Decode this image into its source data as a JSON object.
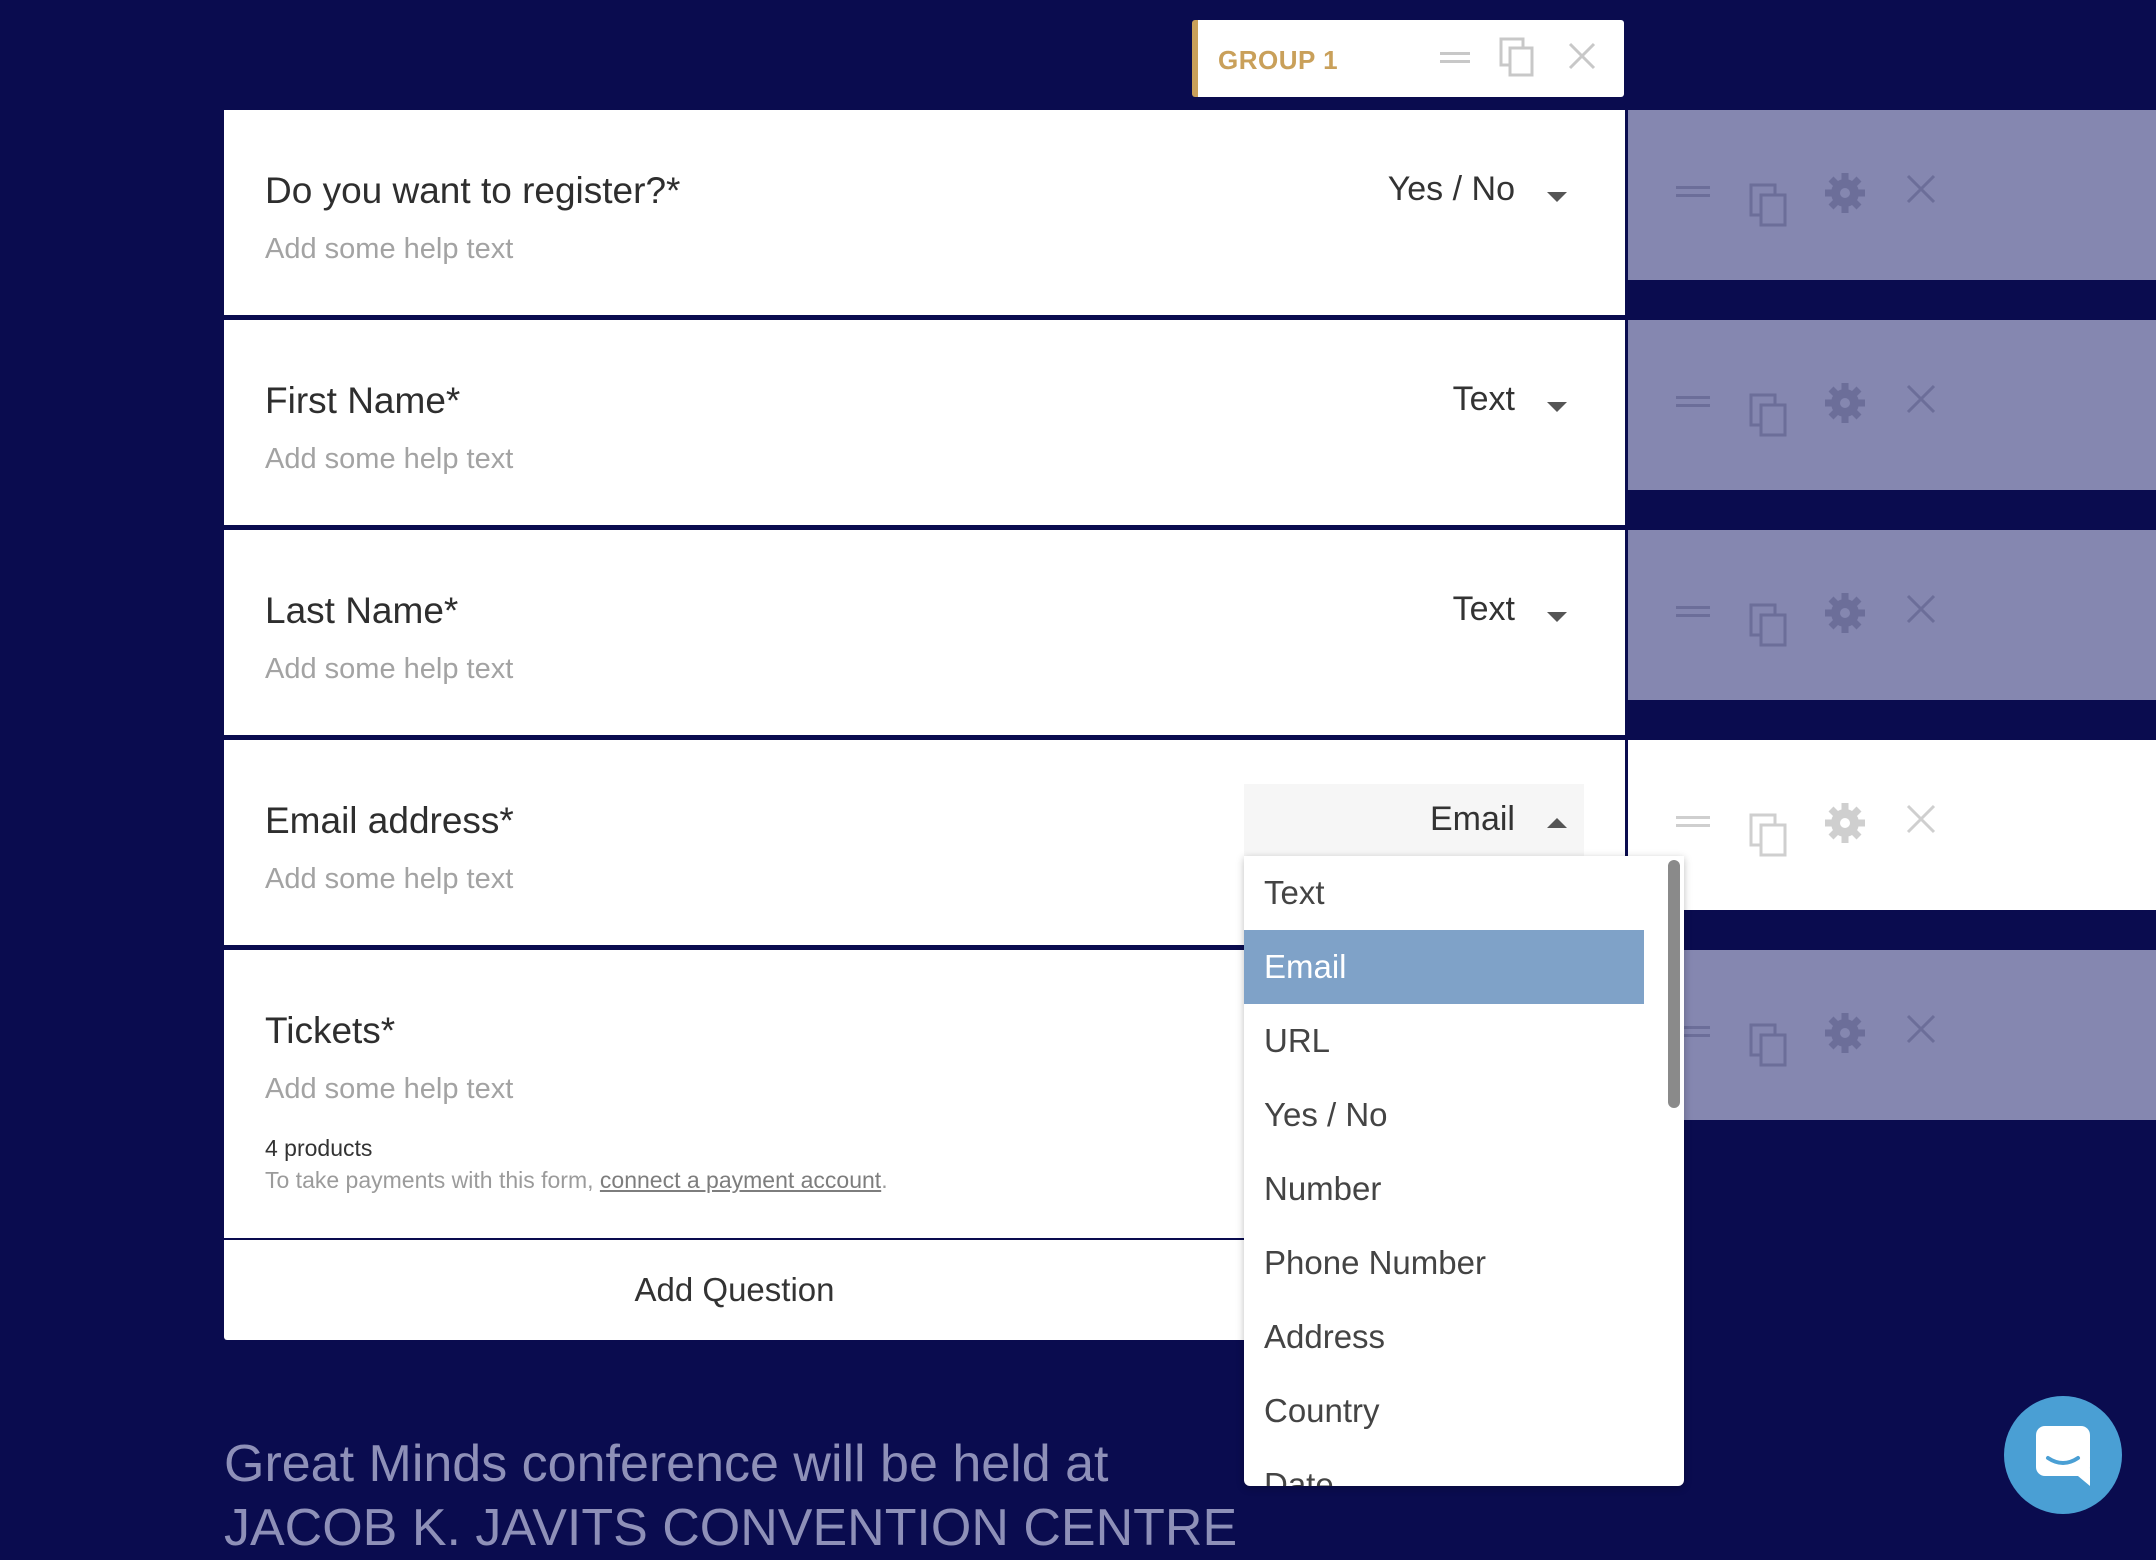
{
  "group": {
    "label": "GROUP 1"
  },
  "questions": [
    {
      "label": "Do you want to register?*",
      "help": "Add some help text",
      "type": "Yes / No"
    },
    {
      "label": "First Name*",
      "help": "Add some help text",
      "type": "Text"
    },
    {
      "label": "Last Name*",
      "help": "Add some help text",
      "type": "Text"
    },
    {
      "label": "Email address*",
      "help": "Add some help text",
      "type": "Email"
    },
    {
      "label": "Tickets*",
      "help": "Add some help text",
      "products": "4 products",
      "payment_note": "To take payments with this form, ",
      "payment_link": "connect a payment account",
      "payment_end": "."
    }
  ],
  "add_question": "Add Question",
  "dropdown": {
    "selected": "Email",
    "options": [
      "Text",
      "Email",
      "URL",
      "Yes / No",
      "Number",
      "Phone Number",
      "Address",
      "Country",
      "Date"
    ]
  },
  "footer": {
    "line1": "Great Minds conference will be held at",
    "line2": "JACOB K. JAVITS CONVENTION CENTRE"
  },
  "colors": {
    "background": "#0a0c4f",
    "accent": "#c9a05a",
    "selected_option": "#7fa2c8",
    "chat_button": "#4a9fd4"
  },
  "icons": [
    "drag-handle-icon",
    "duplicate-icon",
    "settings-gear-icon",
    "close-icon",
    "chat-icon"
  ]
}
